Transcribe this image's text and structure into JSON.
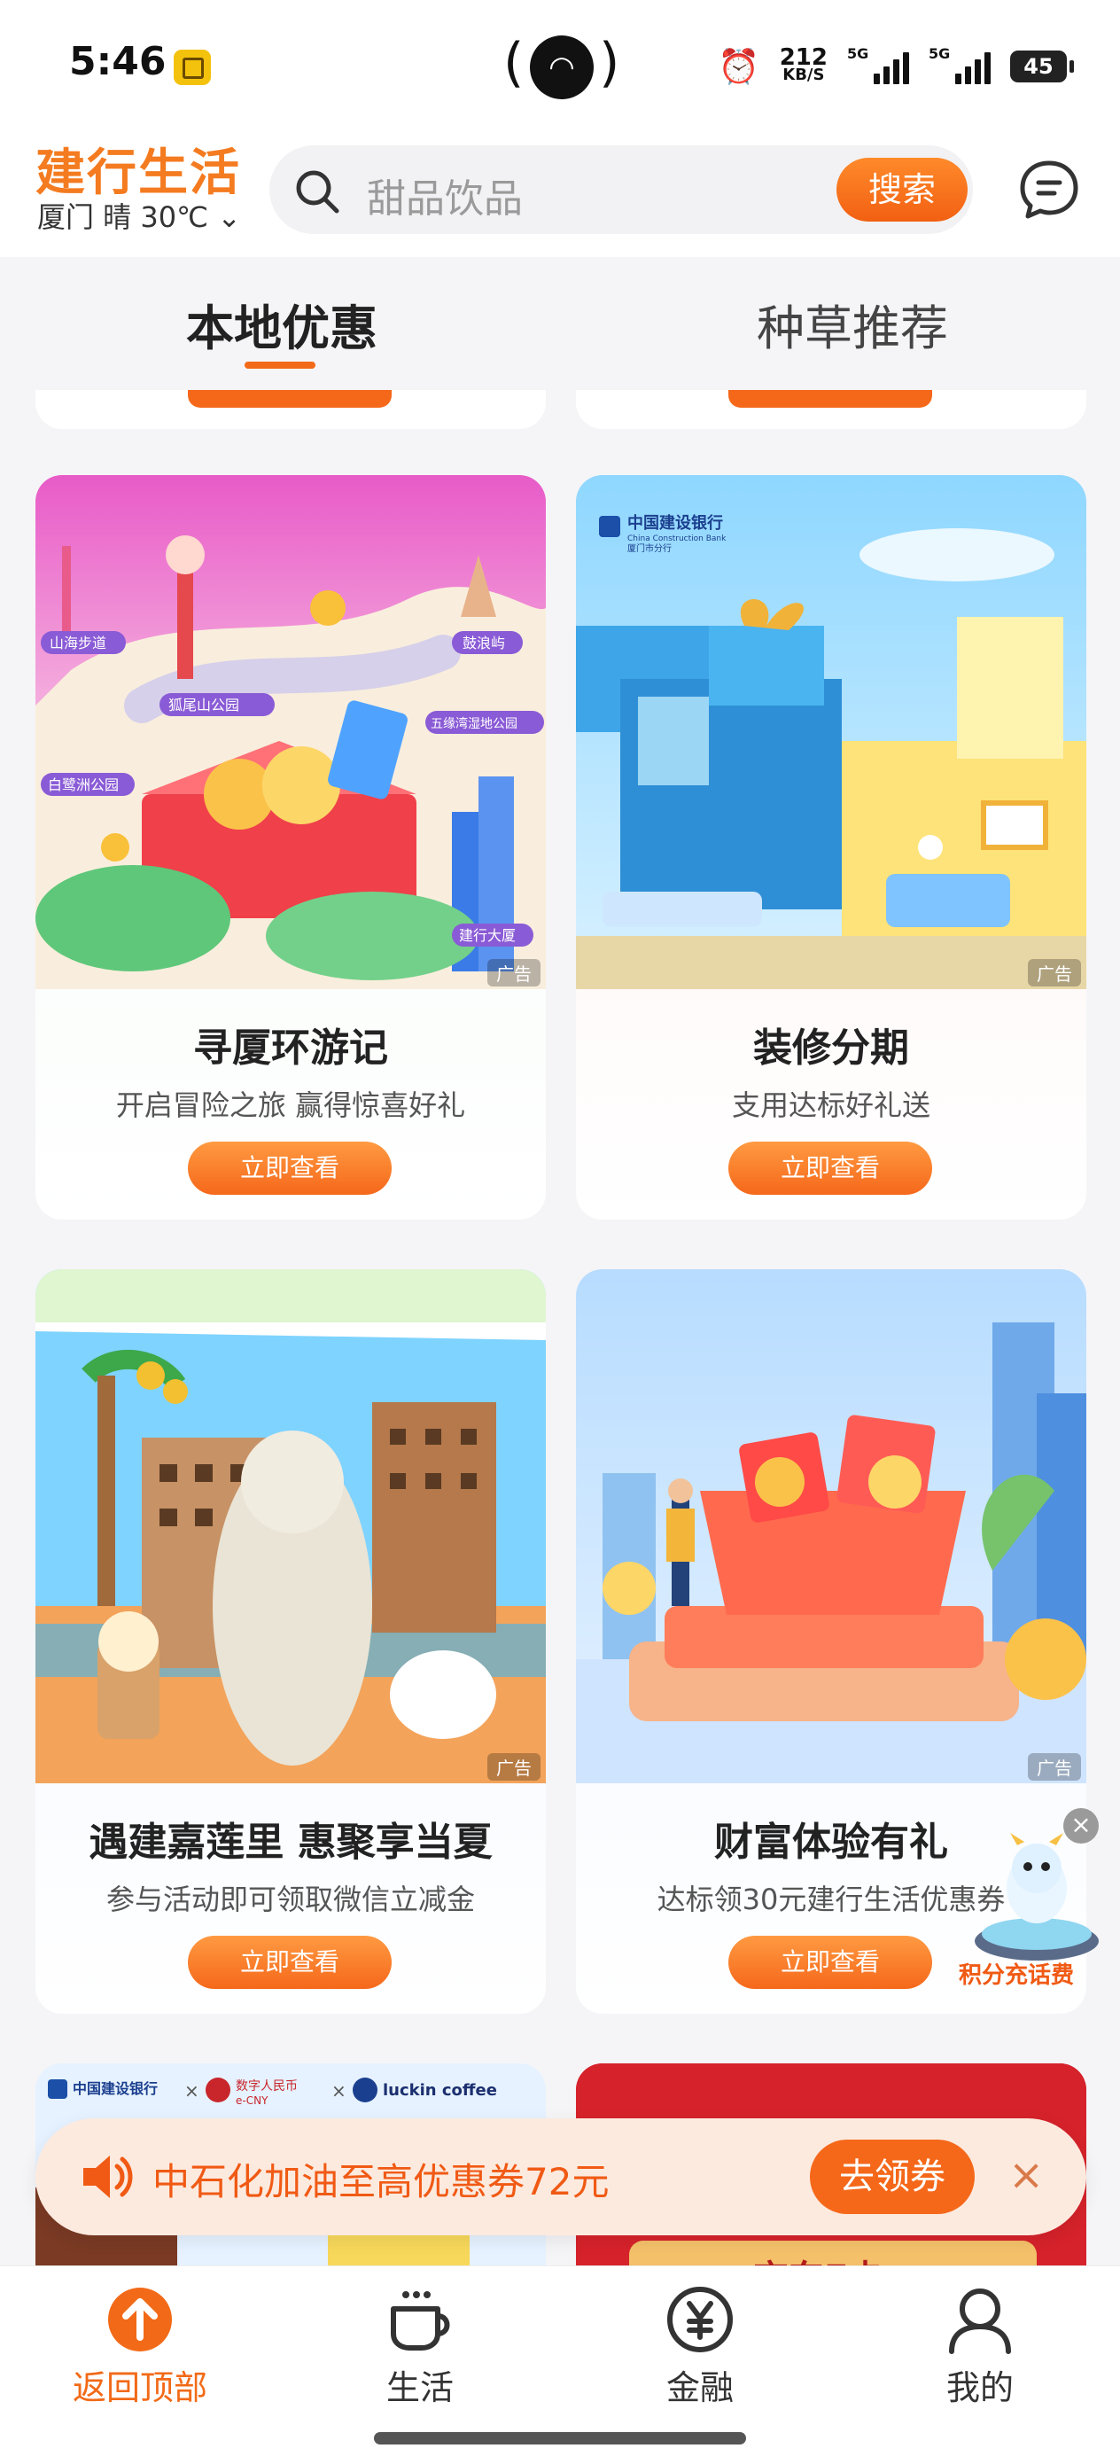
{
  "status_bar": {
    "time": "5:46",
    "network_speed": "212",
    "network_unit": "KB/S",
    "sim1_tag": "5G",
    "sim2_tag": "5G",
    "battery": "45"
  },
  "header": {
    "brand": "建行生活",
    "location_weather": "厦门 晴 30℃",
    "search_placeholder": "甜品饮品",
    "search_button": "搜索"
  },
  "tabs": [
    {
      "label": "本地优惠",
      "active": true
    },
    {
      "label": "种草推荐",
      "active": false
    }
  ],
  "cards": [
    {
      "title": "寻厦环游记",
      "subtitle": "开启冒险之旅 赢得惊喜好礼",
      "button": "立即查看",
      "ad_tag": "广告",
      "map_labels": [
        "山海步道",
        "鼓浪屿",
        "狐尾山公园",
        "五缘湾湿地公园",
        "白鹭洲公园",
        "建行大厦"
      ]
    },
    {
      "title": "装修分期",
      "subtitle": "支用达标好礼送",
      "button": "立即查看",
      "ad_tag": "广告",
      "bank_name": "中国建设银行",
      "bank_name_en": "China Construction Bank",
      "bank_branch": "厦门市分行"
    },
    {
      "title": "遇建嘉莲里 惠聚享当夏",
      "subtitle": "参与活动即可领取微信立减金",
      "button": "立即查看",
      "ad_tag": "广告"
    },
    {
      "title": "财富体验有礼",
      "subtitle": "达标领30元建行生活优惠券",
      "button": "立即查看",
      "ad_tag": "广告"
    },
    {
      "bank_name": "中国建设银行",
      "partner1": "数字人民币",
      "partner1_sub": "e-CNY",
      "partner2": "luckin coffee"
    },
    {
      "partial_text": "京东E卡"
    }
  ],
  "float_badge": {
    "label": "积分充话费",
    "close": "×"
  },
  "notice": {
    "text": "中石化加油至高优惠券72元",
    "button": "去领券",
    "close": "×"
  },
  "bottom_nav": [
    {
      "label": "返回顶部",
      "icon": "arrow-up-icon",
      "active": true
    },
    {
      "label": "生活",
      "icon": "coffee-cup-icon",
      "active": false
    },
    {
      "label": "金融",
      "icon": "yuan-icon",
      "active": false
    },
    {
      "label": "我的",
      "icon": "user-icon",
      "active": false
    }
  ],
  "colors": {
    "accent": "#f26a17",
    "brand": "#f47b20"
  }
}
